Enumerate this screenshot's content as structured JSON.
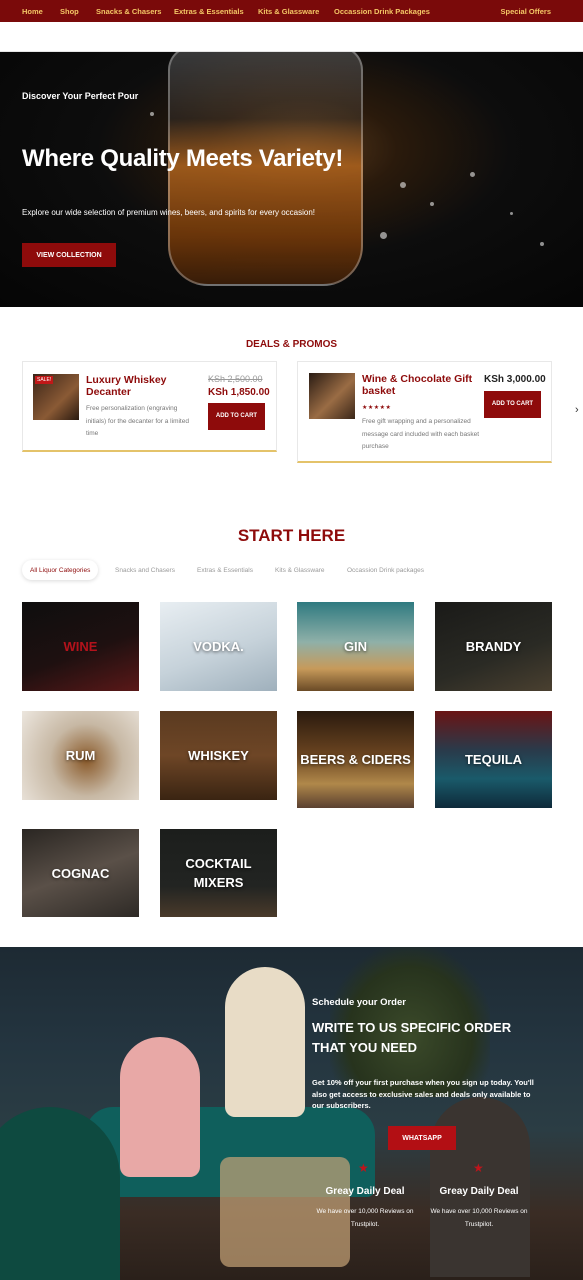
{
  "nav": {
    "items": [
      "Home",
      "Shop",
      "Snacks & Chasers",
      "Extras & Essentials",
      "Kits & Glassware",
      "Occassion Drink Packages"
    ],
    "special": "Special Offers"
  },
  "hero": {
    "kicker": "Discover Your Perfect Pour",
    "title": "Where Quality Meets Variety!",
    "subtitle": "Explore our wide selection of premium wines, beers, and spirits for every occasion!",
    "button": "VIEW COLLECTION"
  },
  "deals": {
    "title": "DEALS & PROMOS",
    "items": [
      {
        "badge": "SALE!",
        "name": "Luxury Whiskey Decanter",
        "old_price": "KSh 2,500.00",
        "price": "KSh 1,850.00",
        "description": "Free personalization (engraving initials) for the decanter for a limited time",
        "button": "ADD TO CART"
      },
      {
        "name": "Wine & Chocolate Gift basket",
        "price": "KSh 3,000.00",
        "rating": 5,
        "description": "Free gift wrapping and a personalized message card included with each basket purchase",
        "button": "ADD TO CART"
      }
    ],
    "next_icon": "chevron-right-icon"
  },
  "start": {
    "title": "START HERE",
    "tabs": [
      "All Liquor Categories",
      "Snacks and Chasers",
      "Extras & Essentials",
      "Kits & Glassware",
      "Occassion Drink packages"
    ],
    "categories": [
      "WINE",
      "VODKA.",
      "GIN",
      "BRANDY",
      "RUM",
      "WHISKEY",
      "BEERS & CIDERS",
      "TEQUILA",
      "COGNAC",
      "COCKTAIL MIXERS"
    ]
  },
  "order": {
    "schedule": "Schedule your Order",
    "heading": "WRITE TO US SPECIFIC ORDER THAT YOU NEED",
    "promo": "Get 10% off your first purchase when you sign up today. You'll also get access to exclusive sales and deals only available to our subscribers.",
    "button": "WHATSAPP",
    "badges": [
      {
        "title": "Greay Daily Deal",
        "text": "We have over 10,000 Reviews on Trustpilot."
      },
      {
        "title": "Greay Daily Deal",
        "text": "We have over 10,000 Reviews on Trustpilot."
      }
    ]
  },
  "colors": {
    "brand": "#8e0b0b",
    "nav_bg": "#7a0a0a",
    "nav_text": "#f4c766",
    "accent_gold": "#e4c36a"
  }
}
